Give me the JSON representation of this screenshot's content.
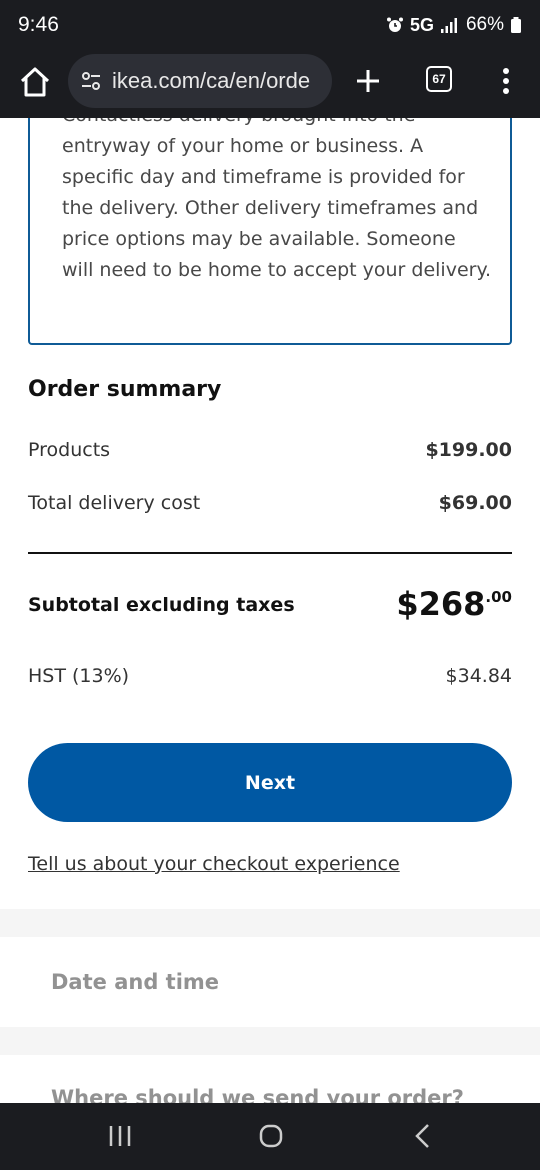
{
  "status_bar": {
    "time": "9:46",
    "network": "5G",
    "battery": "66%",
    "icons": [
      "alarm-icon",
      "signal-icon",
      "battery-icon"
    ]
  },
  "browser": {
    "url": "ikea.com/ca/en/orde",
    "tab_count": "67",
    "icons": [
      "home-icon",
      "site-settings-icon",
      "plus-icon",
      "tabs-icon",
      "more-vert-icon"
    ]
  },
  "delivery_option": {
    "description": "Contactless delivery brought into the entryway of your home or business. A specific day and timeframe is provided for the delivery. Other delivery timeframes and price options may be available. Someone will need to be home to accept your delivery."
  },
  "order_summary": {
    "title": "Order summary",
    "products_label": "Products",
    "products_value": "$199.00",
    "delivery_label": "Total delivery cost",
    "delivery_value": "$69.00",
    "subtotal_label": "Subtotal excluding taxes",
    "subtotal_main": "$268",
    "subtotal_cents": ".00",
    "hst_label": "HST (13%)",
    "hst_value": "$34.84"
  },
  "actions": {
    "next_label": "Next",
    "feedback_link": "Tell us about your checkout experience"
  },
  "steps": {
    "date_time": "Date and time",
    "send_order": "Where should we send your order?"
  },
  "nav_bar": {
    "icons": [
      "recents-icon",
      "home-circle-icon",
      "back-icon"
    ]
  },
  "colors": {
    "accent": "#0058a3",
    "border": "#0f5b96",
    "system_bar": "#1b1c20",
    "muted_text": "#929292"
  }
}
